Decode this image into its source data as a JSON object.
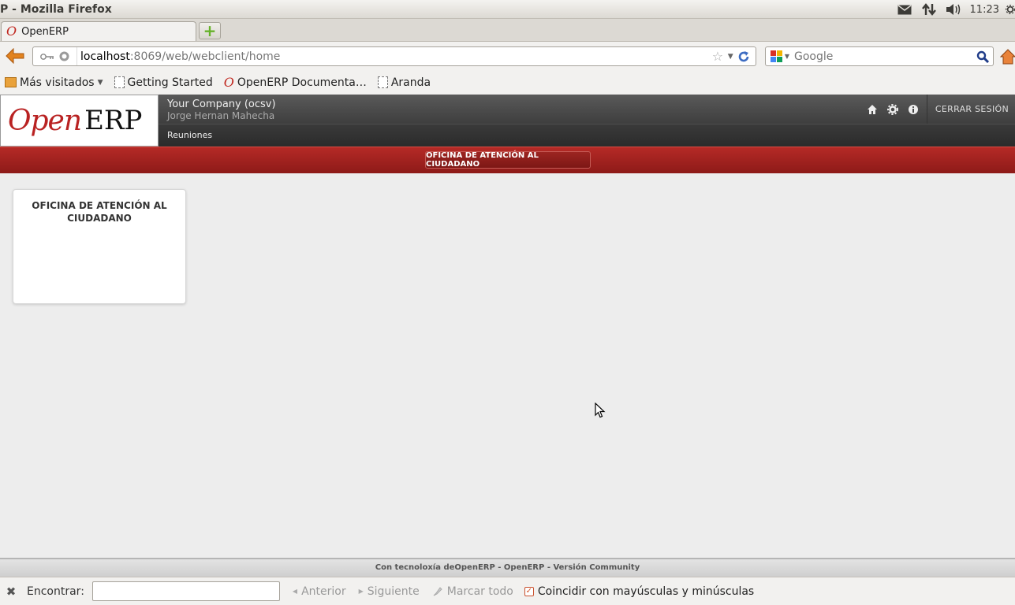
{
  "os": {
    "window_title": "P - Mozilla Firefox",
    "clock": "11:23",
    "tray_icons": [
      "mail-icon",
      "network-icon",
      "volume-icon",
      "gear-icon"
    ]
  },
  "browser": {
    "tab": {
      "label": "OpenERP",
      "favicon": "opera-o-icon"
    },
    "url": {
      "host": "localhost",
      "path": ":8069/web/webclient/home"
    },
    "search": {
      "placeholder": "Google"
    },
    "bookmarks": [
      {
        "label": "Más visitados",
        "icon": "folder-icon"
      },
      {
        "label": "Getting Started",
        "icon": "page-icon"
      },
      {
        "label": "OpenERP Documenta…",
        "icon": "opera-o-icon"
      },
      {
        "label": "Aranda",
        "icon": "page-icon"
      }
    ]
  },
  "openerp": {
    "logo": {
      "open": "Open",
      "erp": "ERP"
    },
    "company": "Your Company (ocsv)",
    "user": "Jorge Hernan Mahecha",
    "logout_label": "CERRAR SESIÓN",
    "menu": [
      "Reuniones"
    ],
    "section_button": "OFICINA DE ATENCIÓN AL CIUDADANO",
    "dashboard": [
      {
        "title": "OFICINA DE ATENCIÓN AL CIUDADANO"
      }
    ],
    "footer": "Con tecnoloxía deOpenERP - OpenERP - Versión Community",
    "brand_red": "#b52a26"
  },
  "findbar": {
    "label": "Encontrar:",
    "value": "",
    "previous": "Anterior",
    "next": "Siguiente",
    "highlight_all": "Marcar todo",
    "match_case": "Coincidir con mayúsculas y minúsculas",
    "match_case_checked": true
  }
}
